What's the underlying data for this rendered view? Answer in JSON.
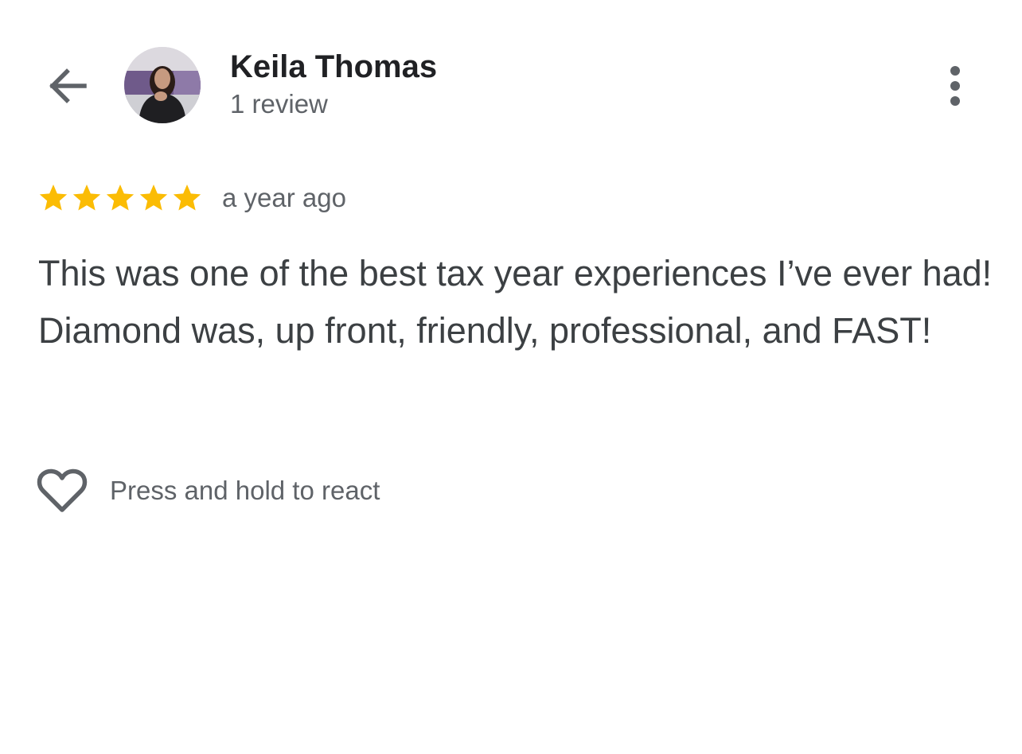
{
  "header": {
    "back_icon": "arrow-left-icon",
    "author_name": "Keila Thomas",
    "review_count": "1 review",
    "more_icon": "more-vertical-icon"
  },
  "review": {
    "rating": 5,
    "rating_max": 5,
    "star_color": "#fbbc04",
    "date": "a year ago",
    "text": "This was one of the best tax year experiences I’ve ever had! Diamond was, up front, friendly, professional, and FAST!"
  },
  "reaction": {
    "icon": "heart-outline-icon",
    "label": "Press and hold to react"
  }
}
